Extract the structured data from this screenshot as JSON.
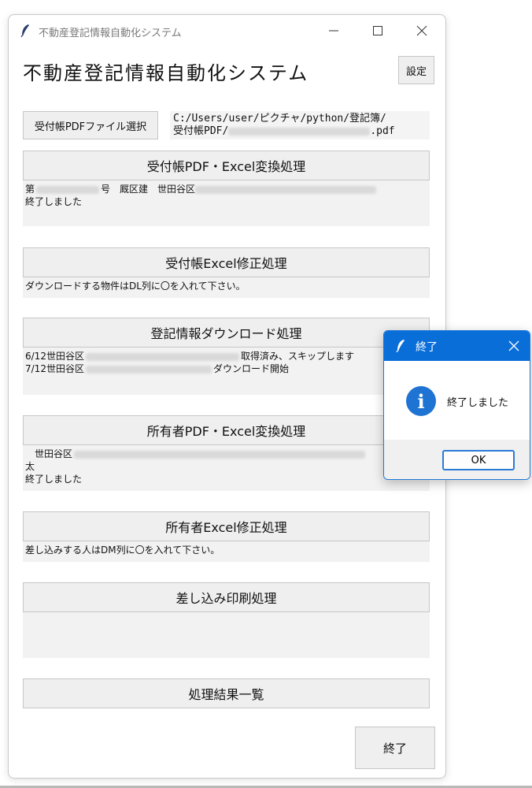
{
  "window": {
    "title": "不動産登記情報自動化システム",
    "controls": {
      "minimize": "—",
      "maximize": "☐",
      "close": "✕"
    }
  },
  "app": {
    "heading": "不動産登記情報自動化システム",
    "settings_button": "設定"
  },
  "file_select": {
    "button": "受付帳PDFファイル選択",
    "path_line1": "C:/Users/user/ピクチャ/python/登記簿/",
    "path_line2_prefix": "受付帳PDF/",
    "path_line2_suffix": ".pdf"
  },
  "sections": {
    "s1": {
      "button": "受付帳PDF・Excel変換処理",
      "log_line1_a": "第",
      "log_line1_b": "号　厩区建　世田谷区",
      "log_line2": "終了しました"
    },
    "s2": {
      "button": "受付帳Excel修正処理",
      "log_line1": "ダウンロードする物件はDL列に〇を入れて下さい。"
    },
    "s3": {
      "button": "登記情報ダウンロード処理",
      "log_line1_a": "6/12世田谷区",
      "log_line1_b": "取得済み、スキップします",
      "log_line2_a": "7/12世田谷区",
      "log_line2_b": "ダウンロード開始"
    },
    "s4": {
      "button": "所有者PDF・Excel変換処理",
      "log_line1": "　世田谷区",
      "log_line2": "太",
      "log_line3": "終了しました"
    },
    "s5": {
      "button": "所有者Excel修正処理",
      "log_line1": "差し込みする人はDM列に〇を入れて下さい。"
    },
    "s6": {
      "button": "差し込み印刷処理"
    },
    "s7": {
      "button": "処理結果一覧"
    }
  },
  "exit_button": "終了",
  "dialog": {
    "title": "終了",
    "icon": "info-icon",
    "message": "終了しました",
    "ok": "OK"
  },
  "colors": {
    "dialog_title": "#0a6ed9",
    "info_icon": "#1f74d3",
    "button_bg": "#efefef"
  }
}
